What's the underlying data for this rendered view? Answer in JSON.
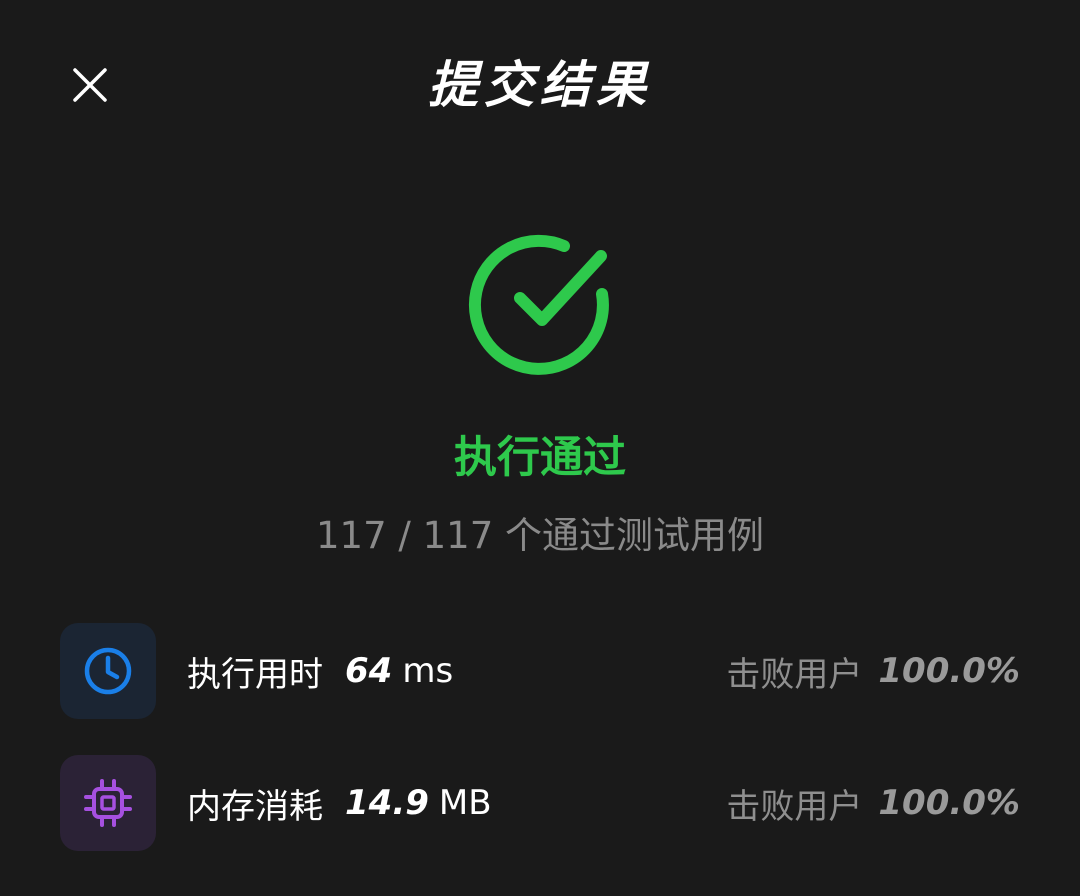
{
  "header": {
    "title": "提交结果",
    "close_icon": "close-icon"
  },
  "result": {
    "icon": "check-circle-icon",
    "status": "执行通过",
    "summary": "117 / 117 个通过测试用例",
    "accent_color": "#2ec94c"
  },
  "metrics": {
    "time": {
      "icon": "clock-icon",
      "icon_color": "#1a7fe8",
      "label": "执行用时",
      "value": "64",
      "unit": "ms",
      "rank_label": "击败用户",
      "rank_value": "100.0%"
    },
    "memory": {
      "icon": "chip-icon",
      "icon_color": "#a650e0",
      "label": "内存消耗",
      "value": "14.9",
      "unit": "MB",
      "rank_label": "击败用户",
      "rank_value": "100.0%"
    }
  }
}
